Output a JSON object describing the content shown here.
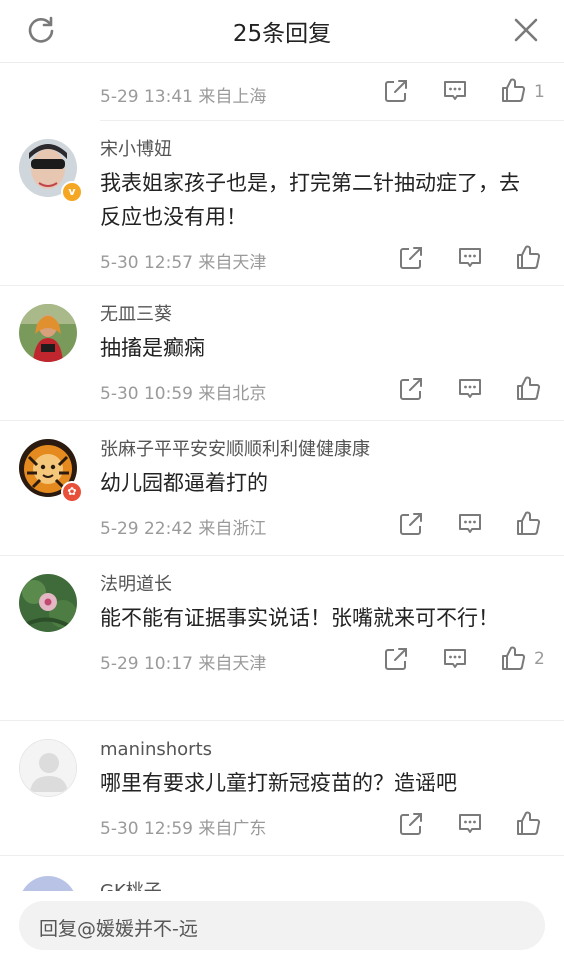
{
  "header": {
    "title": "25条回复"
  },
  "first_reply": {
    "meta": "5-29 13:41  来自上海",
    "like_count": "1"
  },
  "comments": [
    {
      "name": "宋小博妞",
      "text": "我表姐家孩子也是，打完第二针抽动症了，去反应也没有用！",
      "meta": "5-30 12:57  来自天津",
      "like_count": "",
      "badge": "v"
    },
    {
      "name": "无皿三葵",
      "text": "抽搐是癫痫",
      "meta": "5-30 10:59  来自北京",
      "like_count": ""
    },
    {
      "name": "张麻子平平安安顺顺利利健健康康",
      "text": "幼儿园都逼着打的",
      "meta": "5-29 22:42  来自浙江",
      "like_count": "",
      "badge": "red"
    },
    {
      "name": "法明道长",
      "text": "能不能有证据事实说话！张嘴就来可不行！",
      "meta": "5-29 10:17  来自天津",
      "like_count": "2"
    },
    {
      "name": "maninshorts",
      "text": "哪里有要求儿童打新冠疫苗的？造谣吧",
      "meta": "5-30 12:59  来自广东",
      "like_count": ""
    },
    {
      "name": "GK桃子"
    }
  ],
  "footer": {
    "reply_placeholder": "回复@媛媛并不-远"
  },
  "icons": {
    "refresh": "refresh-icon",
    "close": "close-icon",
    "share": "share-icon",
    "comment": "comment-icon",
    "like": "thumbs-up-icon"
  },
  "colors": {
    "icon_gray": "#7a7a7a",
    "meta_gray": "#9a9a9a",
    "badge_gold": "#f5a623",
    "badge_red": "#e8503a"
  }
}
